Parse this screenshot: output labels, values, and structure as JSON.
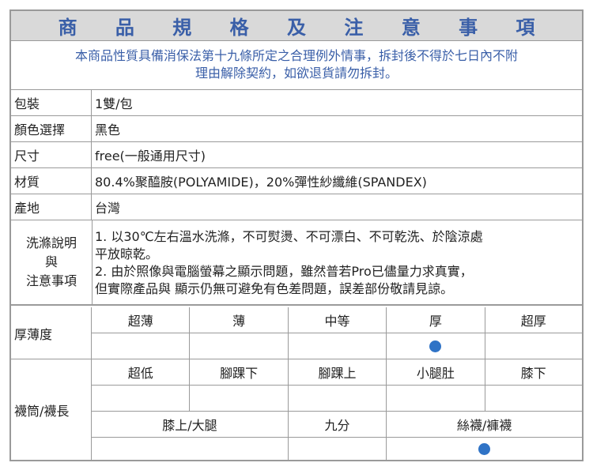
{
  "title": "商 品 規 格 及 注 意 事 項",
  "notice": {
    "line1": "本商品性質具備消保法第十九條所定之合理例外情事，拆封後不得於七日內不附",
    "line2": "理由解除契約，如欲退貨請勿拆封。"
  },
  "specs": {
    "packaging": {
      "label": "包裝",
      "value": "1雙/包"
    },
    "color": {
      "label": "顏色選擇",
      "value": "黑色"
    },
    "size": {
      "label": "尺寸",
      "value": "free(一般通用尺寸)"
    },
    "material": {
      "label": "材質",
      "value": "80.4%聚醯胺(POLYAMIDE)，20%彈性紗纖維(SPANDEX)"
    },
    "origin": {
      "label": "產地",
      "value": "台灣"
    }
  },
  "care": {
    "label_line1": "洗滌說明",
    "label_line2": "與",
    "label_line3": "注意事項",
    "item1_line1": "1. 以30℃左右溫水洗滌，不可熨燙、不可漂白、不可乾洗、於陰涼處",
    "item1_line2": "平放晾乾。",
    "item2_line1": "2. 由於照像與電腦螢幕之顯示問題，雖然普若Pro已儘量力求真實，",
    "item2_line2": "但實際產品與 顯示仍無可避免有色差問題，誤差部份敬請見諒。"
  },
  "thickness": {
    "label": "厚薄度",
    "options": [
      "超薄",
      "薄",
      "中等",
      "厚",
      "超厚"
    ],
    "selected_index": 3
  },
  "length": {
    "label": "襪筒/襪長",
    "options_row1": [
      "超低",
      "腳踝下",
      "腳踝上",
      "小腿肚",
      "膝下"
    ],
    "options_row2": [
      "膝上/大腿",
      "九分",
      "絲襪/褲襪"
    ],
    "selected_row1_index": null,
    "selected_row2_index": 2
  },
  "colors": {
    "accent": "#3a5fa8",
    "marker": "#2f73c6",
    "header_bg": "#d9d9d9",
    "border": "#9a9a9a"
  }
}
